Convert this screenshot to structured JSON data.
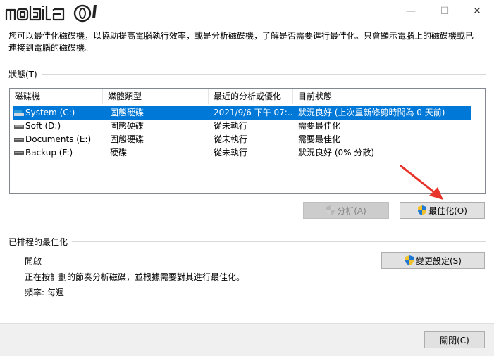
{
  "window": {
    "logo_text": "mobile01",
    "controls": {
      "minimize": "—",
      "maximize": "☐",
      "close": "✕"
    }
  },
  "intro": "您可以最佳化磁碟機，以協助提高電腦執行效率，或是分析磁碟機，了解是否需要進行最佳化。只會顯示電腦上的磁碟機或已連接到電腦的磁碟機。",
  "status": {
    "label": "狀態(T)",
    "columns": [
      "磁碟機",
      "媒體類型",
      "最近的分析或優化",
      "目前狀態"
    ],
    "rows": [
      {
        "drive": "System (C:)",
        "media": "固態硬碟",
        "last": "2021/9/6 下午 07:...",
        "state": "狀況良好 (上次重新修剪時間為 0 天前)",
        "selected": true,
        "icon": "system-drive-icon"
      },
      {
        "drive": "Soft (D:)",
        "media": "固態硬碟",
        "last": "從未執行",
        "state": "需要最佳化",
        "selected": false,
        "icon": "drive-icon"
      },
      {
        "drive": "Documents (E:)",
        "media": "固態硬碟",
        "last": "從未執行",
        "state": "需要最佳化",
        "selected": false,
        "icon": "drive-icon"
      },
      {
        "drive": "Backup (F:)",
        "media": "硬碟",
        "last": "從未執行",
        "state": "狀況良好 (0% 分散)",
        "selected": false,
        "icon": "drive-icon"
      }
    ],
    "analyze_label": "分析(A)",
    "optimize_label": "最佳化(O)"
  },
  "scheduled": {
    "label": "已排程的最佳化",
    "state": "開啟",
    "description": "正在按計劃的節奏分析磁碟，並根據需要對其進行最佳化。",
    "frequency": "頻率: 每週",
    "change_label": "變更設定(S)"
  },
  "footer": {
    "close_label": "關閉(C)"
  },
  "colors": {
    "selection": "#0078d7",
    "arrow": "#e8332a"
  }
}
